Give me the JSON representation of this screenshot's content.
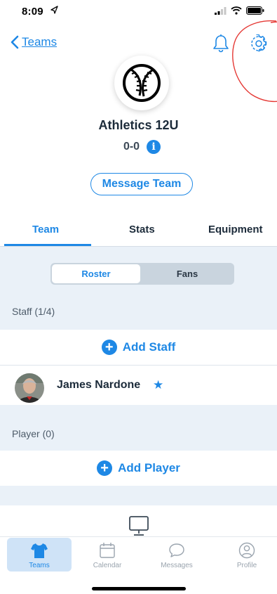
{
  "status": {
    "time": "8:09"
  },
  "nav": {
    "back_label": "Teams"
  },
  "team": {
    "name": "Athletics 12U",
    "record": "0-0",
    "info_glyph": "i"
  },
  "actions": {
    "message_team": "Message Team"
  },
  "tabs": [
    {
      "label": "Team",
      "selected": true
    },
    {
      "label": "Stats",
      "selected": false
    },
    {
      "label": "Equipment",
      "selected": false
    }
  ],
  "segment": {
    "roster": "Roster",
    "fans": "Fans",
    "selected": "Roster"
  },
  "staff": {
    "header": "Staff (1/4)",
    "add_label": "Add Staff",
    "members": [
      {
        "name": "James Nardone",
        "starred": true
      }
    ]
  },
  "players": {
    "header": "Player (0)",
    "add_label": "Add Player"
  },
  "tabbar": [
    {
      "label": "Teams",
      "icon": "jersey-icon",
      "active": true
    },
    {
      "label": "Calendar",
      "icon": "calendar-icon",
      "active": false
    },
    {
      "label": "Messages",
      "icon": "chat-bubble-icon",
      "active": false
    },
    {
      "label": "Profile",
      "icon": "profile-icon",
      "active": false
    }
  ],
  "colors": {
    "accent": "#1e88e5",
    "content_bg": "#eaf1f8",
    "annotation_red": "#e53935"
  }
}
